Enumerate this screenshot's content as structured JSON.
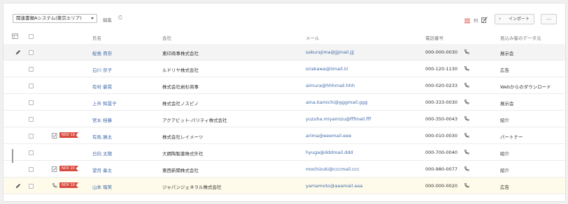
{
  "toolbar": {
    "view_selector": "関連書類Aシステム(東京エリア)",
    "edit_label": "編集",
    "columns_label": "列",
    "import_label": "インポート",
    "plus_glyph": "+",
    "more_glyph": "…"
  },
  "table": {
    "headers": {
      "name": "氏名",
      "company": "会社",
      "email": "メール",
      "phone": "電話番号",
      "source": "見込み客のデータ元"
    },
    "rows": [
      {
        "name": "桜島 貴奈",
        "company": "東印商事株式会社",
        "email": "sakurajima@jjjmail.jjj",
        "phone": "000-000-0030",
        "source": "展示会",
        "selected": true,
        "pencil": true,
        "task": false,
        "date_badge": ""
      },
      {
        "name": "白川 奈子",
        "company": "ルドリヤ株式会社",
        "email": "sirakawa@iimail.iii",
        "phone": "000-120-1130",
        "source": "広告",
        "task": false,
        "date_badge": ""
      },
      {
        "name": "有村 豪晃",
        "company": "株式会社岩杉商事",
        "email": "aimura@hhhmail.hhh",
        "phone": "000-020-0233",
        "source": "Webからのダウンロード",
        "task": false,
        "date_badge": ""
      },
      {
        "name": "上市 知冨子",
        "company": "株式会社ノスピノ",
        "email": "aina.kamichi@gggmail.ggg",
        "phone": "000-333-0030",
        "source": "展示会",
        "task": false,
        "date_badge": ""
      },
      {
        "name": "宮水 桂藤",
        "company": "アクアビット-パリティ株式会社",
        "email": "yuzuha.miyamizu@fffmail.fff",
        "phone": "000-350-0043",
        "source": "紹介",
        "task": false,
        "date_badge": ""
      },
      {
        "name": "有馬 勝太",
        "company": "株式会社レイメーツ",
        "email": "arima@eeemail.eee",
        "phone": "000-010-0030",
        "source": "パートナー",
        "task": true,
        "task_icon": "task-check-icon",
        "date_badge": "NOV 19"
      },
      {
        "name": "日向 太陽",
        "company": "大鋼陶製薬株式外社",
        "email": "hyuga@dddmail.ddd",
        "phone": "000-700-0040",
        "source": "紹介",
        "task": false,
        "date_badge": ""
      },
      {
        "name": "望月 秦太",
        "company": "東西新聞株式会社",
        "email": "mochizuki@cccmail.ccc",
        "phone": "000-980-0077",
        "source": "紹介",
        "task": true,
        "task_icon": "task-check-icon",
        "date_badge": "NOV 20"
      },
      {
        "name": "山本 瑠美",
        "company": "ジャパンジェネラル株式会社",
        "email": "yamamoto@aaamail.aaa",
        "phone": "000-000-0020",
        "source": "広告",
        "highlighted": true,
        "pencil": true,
        "task": true,
        "task_icon": "phone-icon",
        "date_badge": "NOV 19"
      }
    ]
  },
  "colors": {
    "accent_red": "#d94b3e",
    "link_blue": "#3f6aa8",
    "selected_row": "#f4f4f4",
    "highlight_row": "#fffbea"
  }
}
